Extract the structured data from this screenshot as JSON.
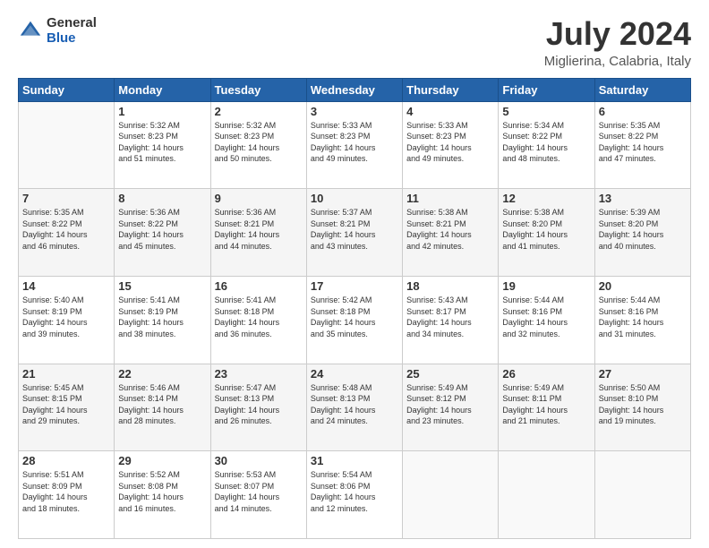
{
  "header": {
    "logo_general": "General",
    "logo_blue": "Blue",
    "title": "July 2024",
    "subtitle": "Miglierina, Calabria, Italy"
  },
  "calendar": {
    "weekdays": [
      "Sunday",
      "Monday",
      "Tuesday",
      "Wednesday",
      "Thursday",
      "Friday",
      "Saturday"
    ],
    "rows": [
      [
        {
          "day": "",
          "info": ""
        },
        {
          "day": "1",
          "info": "Sunrise: 5:32 AM\nSunset: 8:23 PM\nDaylight: 14 hours\nand 51 minutes."
        },
        {
          "day": "2",
          "info": "Sunrise: 5:32 AM\nSunset: 8:23 PM\nDaylight: 14 hours\nand 50 minutes."
        },
        {
          "day": "3",
          "info": "Sunrise: 5:33 AM\nSunset: 8:23 PM\nDaylight: 14 hours\nand 49 minutes."
        },
        {
          "day": "4",
          "info": "Sunrise: 5:33 AM\nSunset: 8:23 PM\nDaylight: 14 hours\nand 49 minutes."
        },
        {
          "day": "5",
          "info": "Sunrise: 5:34 AM\nSunset: 8:22 PM\nDaylight: 14 hours\nand 48 minutes."
        },
        {
          "day": "6",
          "info": "Sunrise: 5:35 AM\nSunset: 8:22 PM\nDaylight: 14 hours\nand 47 minutes."
        }
      ],
      [
        {
          "day": "7",
          "info": "Sunrise: 5:35 AM\nSunset: 8:22 PM\nDaylight: 14 hours\nand 46 minutes."
        },
        {
          "day": "8",
          "info": "Sunrise: 5:36 AM\nSunset: 8:22 PM\nDaylight: 14 hours\nand 45 minutes."
        },
        {
          "day": "9",
          "info": "Sunrise: 5:36 AM\nSunset: 8:21 PM\nDaylight: 14 hours\nand 44 minutes."
        },
        {
          "day": "10",
          "info": "Sunrise: 5:37 AM\nSunset: 8:21 PM\nDaylight: 14 hours\nand 43 minutes."
        },
        {
          "day": "11",
          "info": "Sunrise: 5:38 AM\nSunset: 8:21 PM\nDaylight: 14 hours\nand 42 minutes."
        },
        {
          "day": "12",
          "info": "Sunrise: 5:38 AM\nSunset: 8:20 PM\nDaylight: 14 hours\nand 41 minutes."
        },
        {
          "day": "13",
          "info": "Sunrise: 5:39 AM\nSunset: 8:20 PM\nDaylight: 14 hours\nand 40 minutes."
        }
      ],
      [
        {
          "day": "14",
          "info": "Sunrise: 5:40 AM\nSunset: 8:19 PM\nDaylight: 14 hours\nand 39 minutes."
        },
        {
          "day": "15",
          "info": "Sunrise: 5:41 AM\nSunset: 8:19 PM\nDaylight: 14 hours\nand 38 minutes."
        },
        {
          "day": "16",
          "info": "Sunrise: 5:41 AM\nSunset: 8:18 PM\nDaylight: 14 hours\nand 36 minutes."
        },
        {
          "day": "17",
          "info": "Sunrise: 5:42 AM\nSunset: 8:18 PM\nDaylight: 14 hours\nand 35 minutes."
        },
        {
          "day": "18",
          "info": "Sunrise: 5:43 AM\nSunset: 8:17 PM\nDaylight: 14 hours\nand 34 minutes."
        },
        {
          "day": "19",
          "info": "Sunrise: 5:44 AM\nSunset: 8:16 PM\nDaylight: 14 hours\nand 32 minutes."
        },
        {
          "day": "20",
          "info": "Sunrise: 5:44 AM\nSunset: 8:16 PM\nDaylight: 14 hours\nand 31 minutes."
        }
      ],
      [
        {
          "day": "21",
          "info": "Sunrise: 5:45 AM\nSunset: 8:15 PM\nDaylight: 14 hours\nand 29 minutes."
        },
        {
          "day": "22",
          "info": "Sunrise: 5:46 AM\nSunset: 8:14 PM\nDaylight: 14 hours\nand 28 minutes."
        },
        {
          "day": "23",
          "info": "Sunrise: 5:47 AM\nSunset: 8:13 PM\nDaylight: 14 hours\nand 26 minutes."
        },
        {
          "day": "24",
          "info": "Sunrise: 5:48 AM\nSunset: 8:13 PM\nDaylight: 14 hours\nand 24 minutes."
        },
        {
          "day": "25",
          "info": "Sunrise: 5:49 AM\nSunset: 8:12 PM\nDaylight: 14 hours\nand 23 minutes."
        },
        {
          "day": "26",
          "info": "Sunrise: 5:49 AM\nSunset: 8:11 PM\nDaylight: 14 hours\nand 21 minutes."
        },
        {
          "day": "27",
          "info": "Sunrise: 5:50 AM\nSunset: 8:10 PM\nDaylight: 14 hours\nand 19 minutes."
        }
      ],
      [
        {
          "day": "28",
          "info": "Sunrise: 5:51 AM\nSunset: 8:09 PM\nDaylight: 14 hours\nand 18 minutes."
        },
        {
          "day": "29",
          "info": "Sunrise: 5:52 AM\nSunset: 8:08 PM\nDaylight: 14 hours\nand 16 minutes."
        },
        {
          "day": "30",
          "info": "Sunrise: 5:53 AM\nSunset: 8:07 PM\nDaylight: 14 hours\nand 14 minutes."
        },
        {
          "day": "31",
          "info": "Sunrise: 5:54 AM\nSunset: 8:06 PM\nDaylight: 14 hours\nand 12 minutes."
        },
        {
          "day": "",
          "info": ""
        },
        {
          "day": "",
          "info": ""
        },
        {
          "day": "",
          "info": ""
        }
      ]
    ]
  }
}
